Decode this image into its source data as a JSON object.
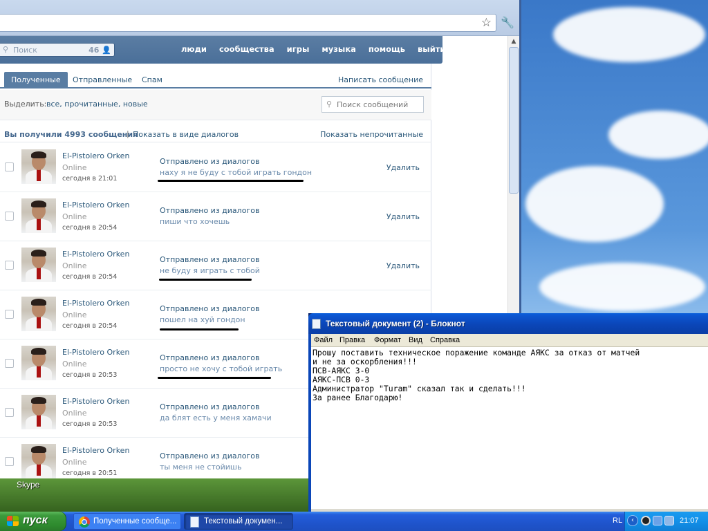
{
  "desktop": {
    "skype_label": "Skype"
  },
  "browser": {
    "star_icon": "star-icon",
    "wrench_icon": "wrench-icon"
  },
  "vk": {
    "search": {
      "placeholder": "Поиск",
      "count": "46"
    },
    "nav": [
      "люди",
      "сообщества",
      "игры",
      "музыка",
      "помощь",
      "выйти"
    ],
    "tabs": [
      "Полученные",
      "Отправленные",
      "Спам"
    ],
    "write_message": "Написать сообщение",
    "filter": {
      "label": "Выделить:",
      "options": "все, прочитанные, новые"
    },
    "message_search_placeholder": "Поиск сообщений",
    "summary": {
      "count": "Вы получили 4993 сообщения",
      "separator": "|",
      "show_dialogs": "Показать в виде диалогов",
      "show_unread": "Показать непрочитанные"
    },
    "messages": [
      {
        "name": "El-Pistolero Orken",
        "status": "Online",
        "time": "сегодня в 21:01",
        "subject": "Отправлено из диалогов",
        "preview": "наху я не буду с тобой играть гондон",
        "delete": "Удалить"
      },
      {
        "name": "El-Pistolero Orken",
        "status": "Online",
        "time": "сегодня в 20:54",
        "subject": "Отправлено из диалогов",
        "preview": "пиши что хочешь",
        "delete": "Удалить"
      },
      {
        "name": "El-Pistolero Orken",
        "status": "Online",
        "time": "сегодня в 20:54",
        "subject": "Отправлено из диалогов",
        "preview": "не буду я играть с тобой",
        "delete": "Удалить"
      },
      {
        "name": "El-Pistolero Orken",
        "status": "Online",
        "time": "сегодня в 20:54",
        "subject": "Отправлено из диалогов",
        "preview": "пошел на хуй гондон",
        "delete": ""
      },
      {
        "name": "El-Pistolero Orken",
        "status": "Online",
        "time": "сегодня в 20:53",
        "subject": "Отправлено из диалогов",
        "preview": "просто не хочу с тобой играть",
        "delete": ""
      },
      {
        "name": "El-Pistolero Orken",
        "status": "Online",
        "time": "сегодня в 20:53",
        "subject": "Отправлено из диалогов",
        "preview": "да блят есть у меня хамачи",
        "delete": ""
      },
      {
        "name": "El-Pistolero Orken",
        "status": "Online",
        "time": "сегодня в 20:51",
        "subject": "Отправлено из диалогов",
        "preview": "ты меня не стойишь",
        "delete": ""
      }
    ]
  },
  "notepad": {
    "title": "Текстовый документ (2) - Блокнот",
    "menu": [
      "Файл",
      "Правка",
      "Формат",
      "Вид",
      "Справка"
    ],
    "lines": [
      "Прошу поставить техническое поражение команде АЯКС за отказ от матчей",
      "и не за оскорбления!!!",
      "ПСВ-АЯКС 3-0",
      "АЯКС-ПСВ 0-3",
      "Администратор \"Turam\" сказал так и сделать!!!",
      "За ранее Благодарю!"
    ]
  },
  "taskbar": {
    "start_label": "пуск",
    "tasks": [
      "Полученные сообще...",
      "Текстовый докумен..."
    ],
    "language": "RL",
    "clock": "21:07"
  }
}
